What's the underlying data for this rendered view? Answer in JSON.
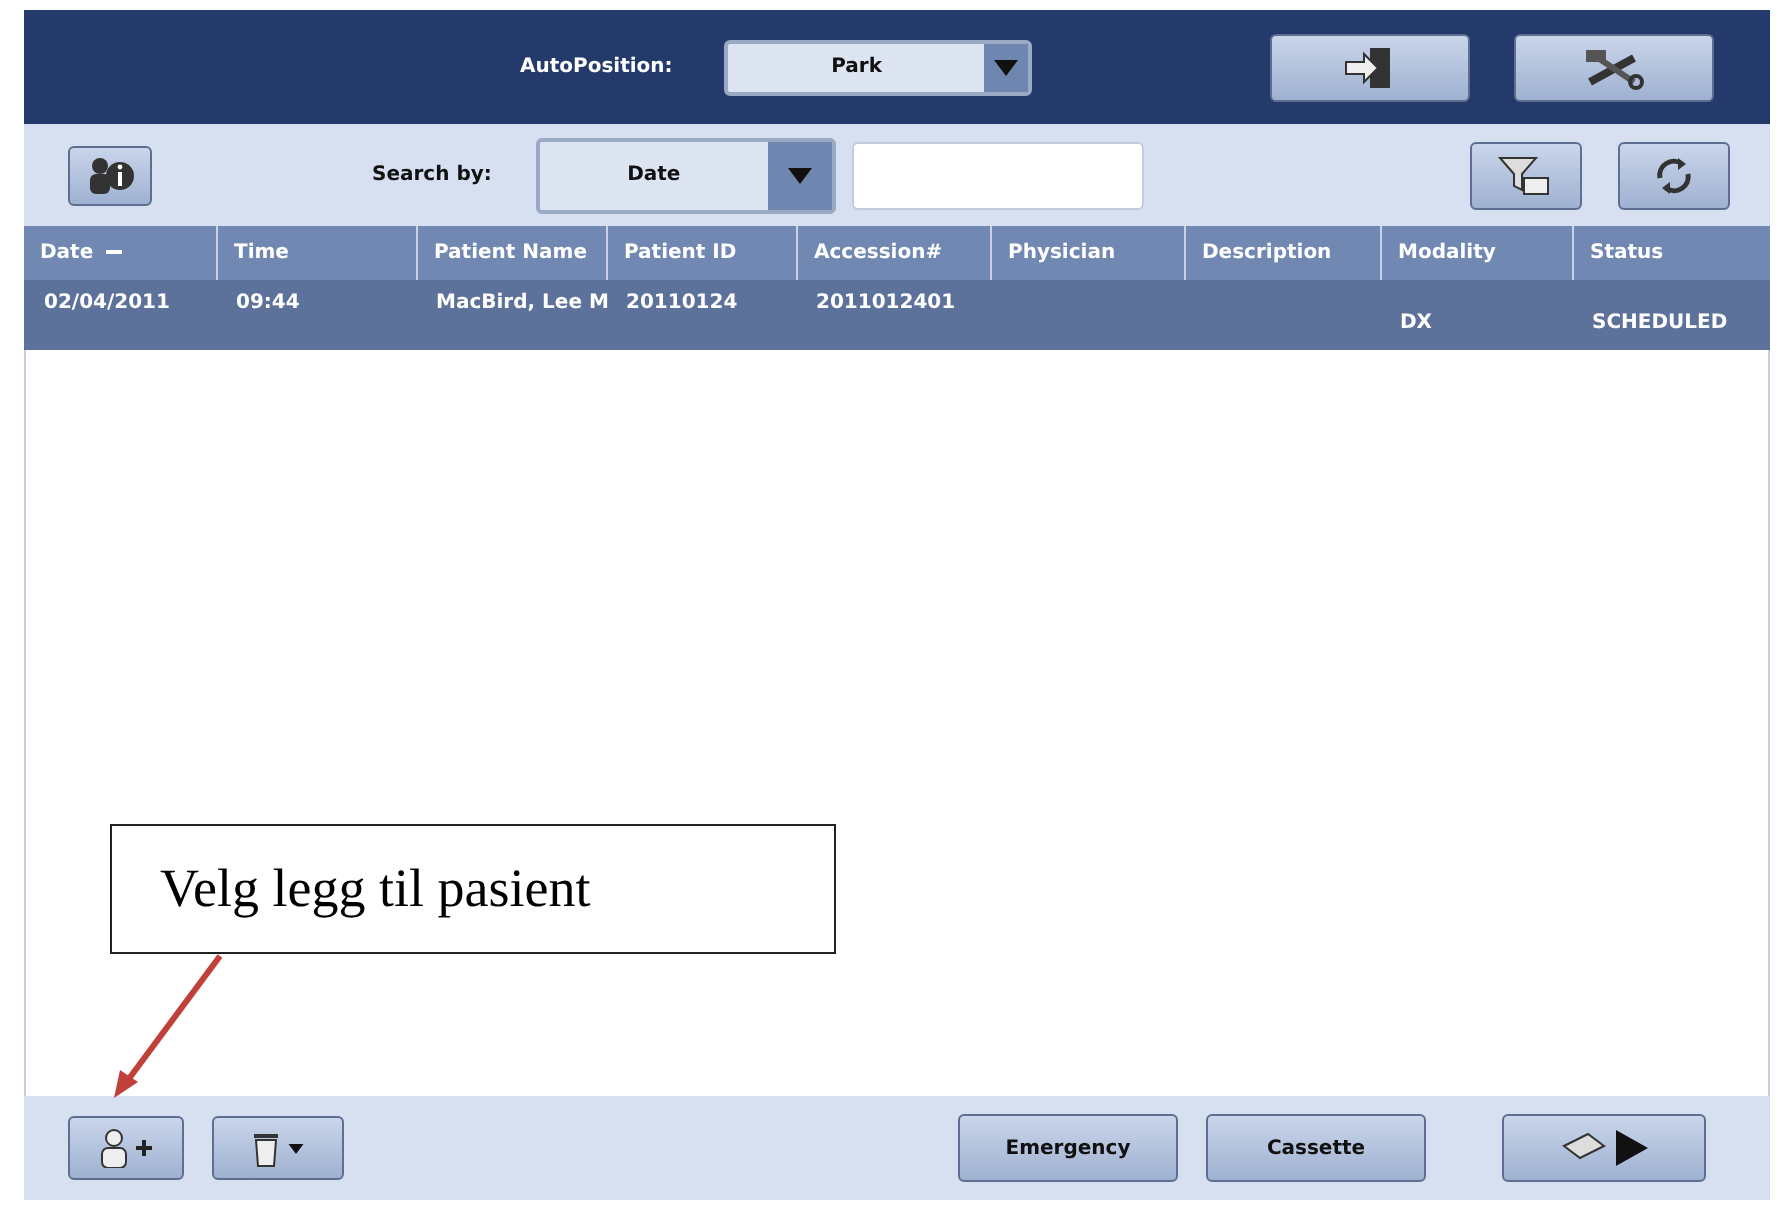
{
  "top_bar": {
    "autoposition_label": "AutoPosition:",
    "autoposition_value": "Park"
  },
  "search_bar": {
    "label": "Search by:",
    "field": "Date"
  },
  "table": {
    "columns": [
      {
        "label": "Date",
        "sorted": true
      },
      {
        "label": "Time",
        "sorted": false
      },
      {
        "label": "Patient Name",
        "sorted": false
      },
      {
        "label": "Patient ID",
        "sorted": false
      },
      {
        "label": "Accession#",
        "sorted": false
      },
      {
        "label": "Physician",
        "sorted": false
      },
      {
        "label": "Description",
        "sorted": false
      },
      {
        "label": "Modality",
        "sorted": false
      },
      {
        "label": "Status",
        "sorted": false
      }
    ],
    "rows": [
      {
        "selected": true,
        "cells": [
          "02/04/2011",
          "09:44",
          "MacBird, Lee M",
          "20110124",
          "2011012401",
          "",
          "",
          "DX",
          "SCHEDULED"
        ]
      }
    ]
  },
  "bottom_bar": {
    "buttons": [
      "Emergency",
      "Cassette"
    ]
  },
  "callout": {
    "text": "Velg legg til pasient"
  }
}
